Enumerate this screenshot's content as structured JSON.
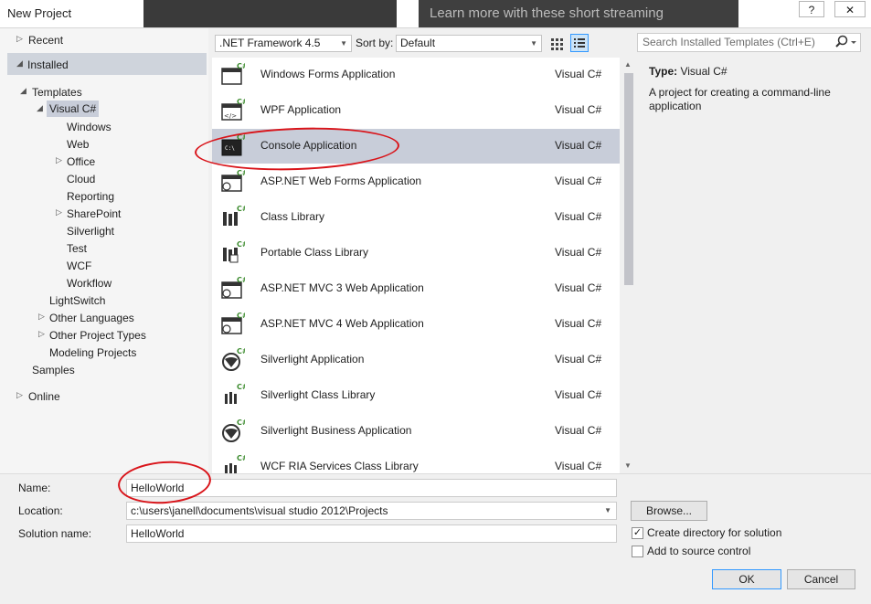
{
  "window": {
    "title": "New Project",
    "background_text": "Learn more with these short streaming",
    "help_label": "?",
    "close_label": "✕"
  },
  "tree": {
    "recent": "Recent",
    "installed": "Installed",
    "templates": "Templates",
    "visual_csharp": "Visual C#",
    "children": [
      "Windows",
      "Web",
      "Office",
      "Cloud",
      "Reporting",
      "SharePoint",
      "Silverlight",
      "Test",
      "WCF",
      "Workflow"
    ],
    "lightswitch": "LightSwitch",
    "other_languages": "Other Languages",
    "other_project_types": "Other Project Types",
    "modeling_projects": "Modeling Projects",
    "samples": "Samples",
    "online": "Online"
  },
  "toolbar": {
    "framework": ".NET Framework 4.5",
    "sort_label": "Sort by:",
    "sort_value": "Default"
  },
  "templates": [
    {
      "name": "Windows Forms Application",
      "lang": "Visual C#",
      "icon": "windows-forms-icon"
    },
    {
      "name": "WPF Application",
      "lang": "Visual C#",
      "icon": "wpf-icon"
    },
    {
      "name": "Console Application",
      "lang": "Visual C#",
      "icon": "console-icon"
    },
    {
      "name": "ASP.NET Web Forms Application",
      "lang": "Visual C#",
      "icon": "web-forms-icon"
    },
    {
      "name": "Class Library",
      "lang": "Visual C#",
      "icon": "class-library-icon"
    },
    {
      "name": "Portable Class Library",
      "lang": "Visual C#",
      "icon": "portable-library-icon"
    },
    {
      "name": "ASP.NET MVC 3 Web Application",
      "lang": "Visual C#",
      "icon": "mvc3-icon"
    },
    {
      "name": "ASP.NET MVC 4 Web Application",
      "lang": "Visual C#",
      "icon": "mvc4-icon"
    },
    {
      "name": "Silverlight Application",
      "lang": "Visual C#",
      "icon": "silverlight-icon"
    },
    {
      "name": "Silverlight Class Library",
      "lang": "Visual C#",
      "icon": "silverlight-library-icon"
    },
    {
      "name": "Silverlight Business Application",
      "lang": "Visual C#",
      "icon": "silverlight-business-icon"
    },
    {
      "name": "WCF RIA Services Class Library",
      "lang": "Visual C#",
      "icon": "wcf-ria-icon"
    }
  ],
  "selected_template": "Console Application",
  "search": {
    "placeholder": "Search Installed Templates (Ctrl+E)"
  },
  "details": {
    "type_label": "Type:",
    "type_value": "Visual C#",
    "description": "A project for creating a command-line application"
  },
  "form": {
    "name_label": "Name:",
    "name_value": "HelloWorld",
    "location_label": "Location:",
    "location_value": "c:\\users\\janell\\documents\\visual studio 2012\\Projects",
    "solution_label": "Solution name:",
    "solution_value": "HelloWorld",
    "browse_label": "Browse...",
    "create_directory_label": "Create directory for solution",
    "create_directory_checked": true,
    "source_control_label": "Add to source control",
    "source_control_checked": false,
    "ok_label": "OK",
    "cancel_label": "Cancel"
  },
  "colors": {
    "selection": "#c8cdd9",
    "installed_highlight": "#cfd4dc",
    "annotation": "#d9141a",
    "csharp_badge": "#3a8a2c"
  }
}
